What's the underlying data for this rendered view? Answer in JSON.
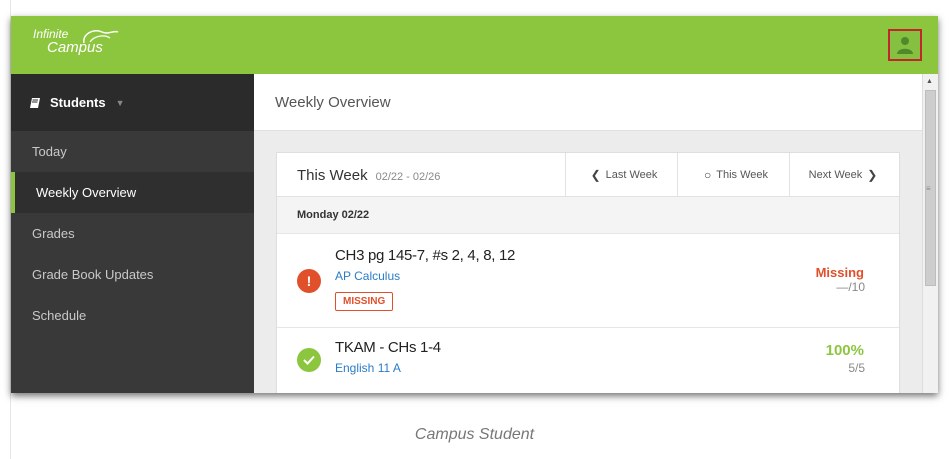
{
  "app": {
    "logo_line1": "Infinite",
    "logo_line2": "Campus",
    "colors": {
      "topbar": "#8cc63f",
      "sidebar": "#393939",
      "missing": "#e0502b",
      "complete": "#8cc63f",
      "link": "#2a7cc7",
      "highlight_border": "#c0262b"
    }
  },
  "sidebar": {
    "header": "Students",
    "items": [
      {
        "label": "Today"
      },
      {
        "label": "Weekly Overview",
        "active": true
      },
      {
        "label": "Grades"
      },
      {
        "label": "Grade Book Updates"
      },
      {
        "label": "Schedule"
      }
    ]
  },
  "main": {
    "title": "Weekly Overview",
    "week": {
      "label": "This Week",
      "range": "02/22 - 02/26",
      "nav": {
        "last": "Last Week",
        "this": "This Week",
        "next": "Next Week"
      }
    },
    "day": "Monday 02/22",
    "assignments": [
      {
        "title": "CH3 pg 145-7, #s 2, 4, 8, 12",
        "course": "AP Calculus",
        "badge": "MISSING",
        "status": "Missing",
        "score": "—/10",
        "icon": "exclamation-icon"
      },
      {
        "title": "TKAM - CHs 1-4",
        "course": "English 11 A",
        "status": "100%",
        "score": "5/5",
        "icon": "checkmark-icon"
      }
    ]
  },
  "caption": "Campus Student"
}
